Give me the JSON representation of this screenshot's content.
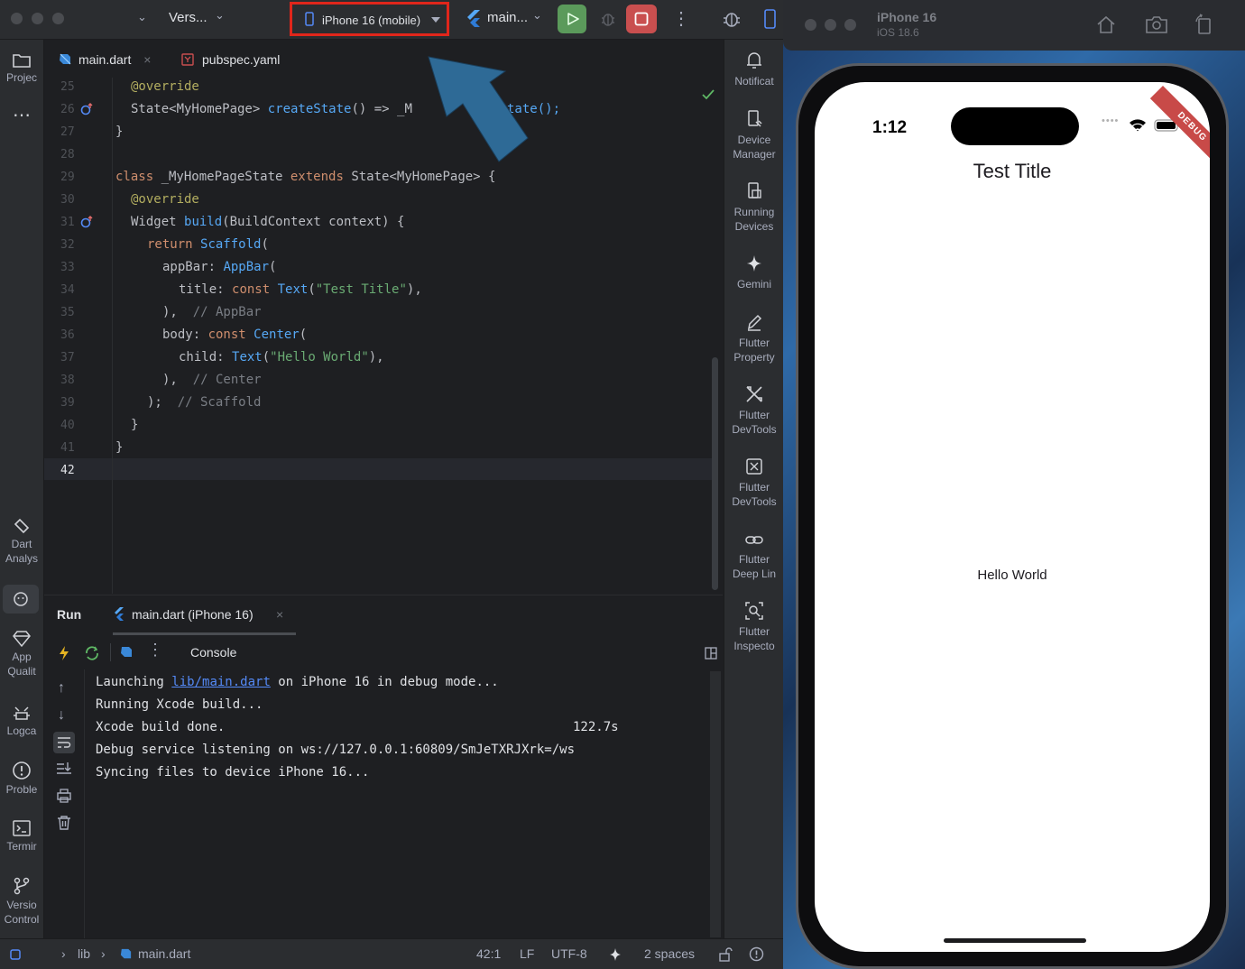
{
  "toolbar": {
    "version_control": "Vers...",
    "device": "iPhone 16 (mobile)",
    "run_config": "main...",
    "accent_highlight": "#e0261b"
  },
  "tabs": [
    {
      "label": "main.dart",
      "icon": "dart-icon"
    },
    {
      "label": "pubspec.yaml",
      "icon": "yaml-icon"
    }
  ],
  "left_tools": [
    "Projec",
    "Dart Analys",
    "App Qualit",
    "Logca",
    "Proble",
    "Termir",
    "Versio Control"
  ],
  "right_tools": {
    "notifications": "Notificat",
    "device_manager": [
      "Device",
      "Manager"
    ],
    "running_devices": [
      "Running",
      "Devices"
    ],
    "gemini": "Gemini",
    "flutter_property": [
      "Flutter",
      "Property"
    ],
    "flutter_devtools_1": [
      "Flutter",
      "DevTools"
    ],
    "flutter_devtools_2": [
      "Flutter",
      "DevTools"
    ],
    "flutter_deep_links": [
      "Flutter",
      "Deep Lin"
    ],
    "flutter_inspector": [
      "Flutter",
      "Inspecto"
    ]
  },
  "code": {
    "line_numbers": [
      "25",
      "26",
      "27",
      "28",
      "29",
      "30",
      "31",
      "32",
      "33",
      "34",
      "35",
      "36",
      "37",
      "38",
      "39",
      "40",
      "41",
      "42"
    ],
    "l25": "@override",
    "l26a": "State<MyHomePage> ",
    "l26b": "createState",
    "l26c": "() => _M",
    "l26d": "tate();",
    "l27": "}",
    "l29a": "class ",
    "l29b": "_MyHomePageState ",
    "l29c": "extends ",
    "l29d": "State<MyHomePage> {",
    "l30": "@override",
    "l31a": "Widget ",
    "l31b": "build",
    "l31c": "(BuildContext context) {",
    "l32a": "return ",
    "l32b": "Scaffold",
    "l32c": "(",
    "l33a": "appBar: ",
    "l33b": "AppBar",
    "l33c": "(",
    "l34a": "title: ",
    "l34b": "const ",
    "l34c": "Text",
    "l34d": "(",
    "l34e": "\"Test Title\"",
    "l34f": "),",
    "l35a": "),  ",
    "l35b": "// AppBar",
    "l36a": "body: ",
    "l36b": "const ",
    "l36c": "Center",
    "l36d": "(",
    "l37a": "child: ",
    "l37b": "Text",
    "l37c": "(",
    "l37d": "\"Hello World\"",
    "l37e": "),",
    "l38a": "),  ",
    "l38b": "// Center",
    "l39a": ");  ",
    "l39b": "// Scaffold",
    "l40": "}",
    "l41": "}"
  },
  "run_panel": {
    "run_tab": "Run",
    "session_tab": "main.dart (iPhone 16)",
    "console_label": "Console",
    "lines": {
      "l1_pre": "Launching ",
      "l1_link": "lib/main.dart",
      "l1_post": " on iPhone 16 in debug mode...",
      "l2": "Running Xcode build...",
      "l3": "Xcode build done.",
      "l3_time": "122.7s",
      "l4": "Debug service listening on ws://127.0.0.1:60809/SmJeTXRJXrk=/ws",
      "l5": "Syncing files to device iPhone 16..."
    }
  },
  "status_bar": {
    "breadcrumb_lib": "lib",
    "breadcrumb_file": "main.dart",
    "position": "42:1",
    "line_sep": "LF",
    "encoding": "UTF-8",
    "indent": "2 spaces"
  },
  "simulator": {
    "device_name": "iPhone 16",
    "os": "iOS 18.6",
    "time": "1:12",
    "debug_banner": "DEBUG",
    "app_title": "Test Title",
    "body_text": "Hello World"
  }
}
